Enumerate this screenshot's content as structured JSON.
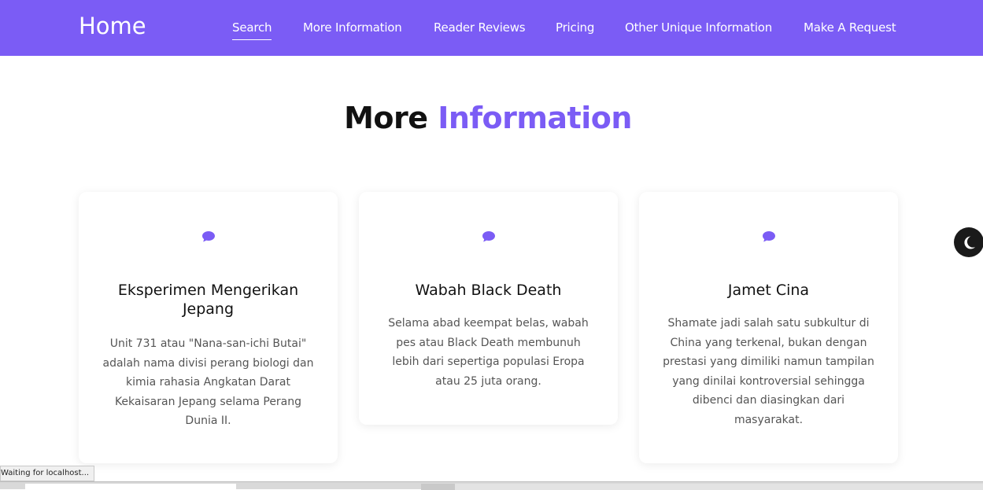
{
  "nav": {
    "brand": "Home",
    "links": [
      {
        "label": "Search",
        "active": true
      },
      {
        "label": "More Information",
        "active": false
      },
      {
        "label": "Reader Reviews",
        "active": false
      },
      {
        "label": "Pricing",
        "active": false
      },
      {
        "label": "Other Unique Information",
        "active": false
      },
      {
        "label": "Make A Request",
        "active": false
      }
    ]
  },
  "section": {
    "title_plain": "More",
    "title_accent": "Information"
  },
  "cards": [
    {
      "icon": "chat-bubble-icon",
      "title": "Eksperimen Mengerikan Jepang",
      "text": "Unit 731 atau \"Nana-san-ichi Butai\" adalah nama divisi perang biologi dan kimia rahasia Angkatan Darat Kekaisaran Jepang selama Perang Dunia II."
    },
    {
      "icon": "chat-bubble-icon",
      "title": "Wabah Black Death",
      "text": "Selama abad keempat belas, wabah pes atau Black Death membunuh lebih dari sepertiga populasi Eropa atau 25 juta orang."
    },
    {
      "icon": "chat-bubble-icon",
      "title": "Jamet Cina",
      "text": "Shamate jadi salah satu subkultur di China yang terkenal, bukan dengan prestasi yang dimiliki namun tampilan yang dinilai kontroversial sehingga dibenci dan diasingkan dari masyarakat."
    }
  ],
  "theme_toggle": {
    "icon": "moon-icon"
  },
  "status": {
    "text": "Waiting for localhost..."
  },
  "colors": {
    "accent": "#7b5cf5",
    "dark": "#1a1a1a"
  }
}
